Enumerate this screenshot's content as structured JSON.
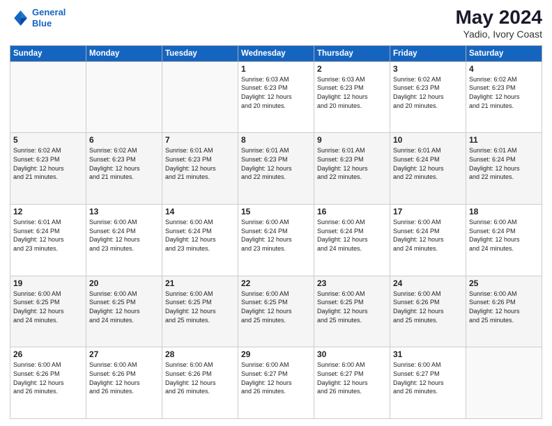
{
  "header": {
    "logo_line1": "General",
    "logo_line2": "Blue",
    "month_year": "May 2024",
    "location": "Yadio, Ivory Coast"
  },
  "days_of_week": [
    "Sunday",
    "Monday",
    "Tuesday",
    "Wednesday",
    "Thursday",
    "Friday",
    "Saturday"
  ],
  "weeks": [
    [
      {
        "day": "",
        "info": ""
      },
      {
        "day": "",
        "info": ""
      },
      {
        "day": "",
        "info": ""
      },
      {
        "day": "1",
        "info": "Sunrise: 6:03 AM\nSunset: 6:23 PM\nDaylight: 12 hours\nand 20 minutes."
      },
      {
        "day": "2",
        "info": "Sunrise: 6:03 AM\nSunset: 6:23 PM\nDaylight: 12 hours\nand 20 minutes."
      },
      {
        "day": "3",
        "info": "Sunrise: 6:02 AM\nSunset: 6:23 PM\nDaylight: 12 hours\nand 20 minutes."
      },
      {
        "day": "4",
        "info": "Sunrise: 6:02 AM\nSunset: 6:23 PM\nDaylight: 12 hours\nand 21 minutes."
      }
    ],
    [
      {
        "day": "5",
        "info": "Sunrise: 6:02 AM\nSunset: 6:23 PM\nDaylight: 12 hours\nand 21 minutes."
      },
      {
        "day": "6",
        "info": "Sunrise: 6:02 AM\nSunset: 6:23 PM\nDaylight: 12 hours\nand 21 minutes."
      },
      {
        "day": "7",
        "info": "Sunrise: 6:01 AM\nSunset: 6:23 PM\nDaylight: 12 hours\nand 21 minutes."
      },
      {
        "day": "8",
        "info": "Sunrise: 6:01 AM\nSunset: 6:23 PM\nDaylight: 12 hours\nand 22 minutes."
      },
      {
        "day": "9",
        "info": "Sunrise: 6:01 AM\nSunset: 6:23 PM\nDaylight: 12 hours\nand 22 minutes."
      },
      {
        "day": "10",
        "info": "Sunrise: 6:01 AM\nSunset: 6:24 PM\nDaylight: 12 hours\nand 22 minutes."
      },
      {
        "day": "11",
        "info": "Sunrise: 6:01 AM\nSunset: 6:24 PM\nDaylight: 12 hours\nand 22 minutes."
      }
    ],
    [
      {
        "day": "12",
        "info": "Sunrise: 6:01 AM\nSunset: 6:24 PM\nDaylight: 12 hours\nand 23 minutes."
      },
      {
        "day": "13",
        "info": "Sunrise: 6:00 AM\nSunset: 6:24 PM\nDaylight: 12 hours\nand 23 minutes."
      },
      {
        "day": "14",
        "info": "Sunrise: 6:00 AM\nSunset: 6:24 PM\nDaylight: 12 hours\nand 23 minutes."
      },
      {
        "day": "15",
        "info": "Sunrise: 6:00 AM\nSunset: 6:24 PM\nDaylight: 12 hours\nand 23 minutes."
      },
      {
        "day": "16",
        "info": "Sunrise: 6:00 AM\nSunset: 6:24 PM\nDaylight: 12 hours\nand 24 minutes."
      },
      {
        "day": "17",
        "info": "Sunrise: 6:00 AM\nSunset: 6:24 PM\nDaylight: 12 hours\nand 24 minutes."
      },
      {
        "day": "18",
        "info": "Sunrise: 6:00 AM\nSunset: 6:24 PM\nDaylight: 12 hours\nand 24 minutes."
      }
    ],
    [
      {
        "day": "19",
        "info": "Sunrise: 6:00 AM\nSunset: 6:25 PM\nDaylight: 12 hours\nand 24 minutes."
      },
      {
        "day": "20",
        "info": "Sunrise: 6:00 AM\nSunset: 6:25 PM\nDaylight: 12 hours\nand 24 minutes."
      },
      {
        "day": "21",
        "info": "Sunrise: 6:00 AM\nSunset: 6:25 PM\nDaylight: 12 hours\nand 25 minutes."
      },
      {
        "day": "22",
        "info": "Sunrise: 6:00 AM\nSunset: 6:25 PM\nDaylight: 12 hours\nand 25 minutes."
      },
      {
        "day": "23",
        "info": "Sunrise: 6:00 AM\nSunset: 6:25 PM\nDaylight: 12 hours\nand 25 minutes."
      },
      {
        "day": "24",
        "info": "Sunrise: 6:00 AM\nSunset: 6:26 PM\nDaylight: 12 hours\nand 25 minutes."
      },
      {
        "day": "25",
        "info": "Sunrise: 6:00 AM\nSunset: 6:26 PM\nDaylight: 12 hours\nand 25 minutes."
      }
    ],
    [
      {
        "day": "26",
        "info": "Sunrise: 6:00 AM\nSunset: 6:26 PM\nDaylight: 12 hours\nand 26 minutes."
      },
      {
        "day": "27",
        "info": "Sunrise: 6:00 AM\nSunset: 6:26 PM\nDaylight: 12 hours\nand 26 minutes."
      },
      {
        "day": "28",
        "info": "Sunrise: 6:00 AM\nSunset: 6:26 PM\nDaylight: 12 hours\nand 26 minutes."
      },
      {
        "day": "29",
        "info": "Sunrise: 6:00 AM\nSunset: 6:27 PM\nDaylight: 12 hours\nand 26 minutes."
      },
      {
        "day": "30",
        "info": "Sunrise: 6:00 AM\nSunset: 6:27 PM\nDaylight: 12 hours\nand 26 minutes."
      },
      {
        "day": "31",
        "info": "Sunrise: 6:00 AM\nSunset: 6:27 PM\nDaylight: 12 hours\nand 26 minutes."
      },
      {
        "day": "",
        "info": ""
      }
    ]
  ]
}
